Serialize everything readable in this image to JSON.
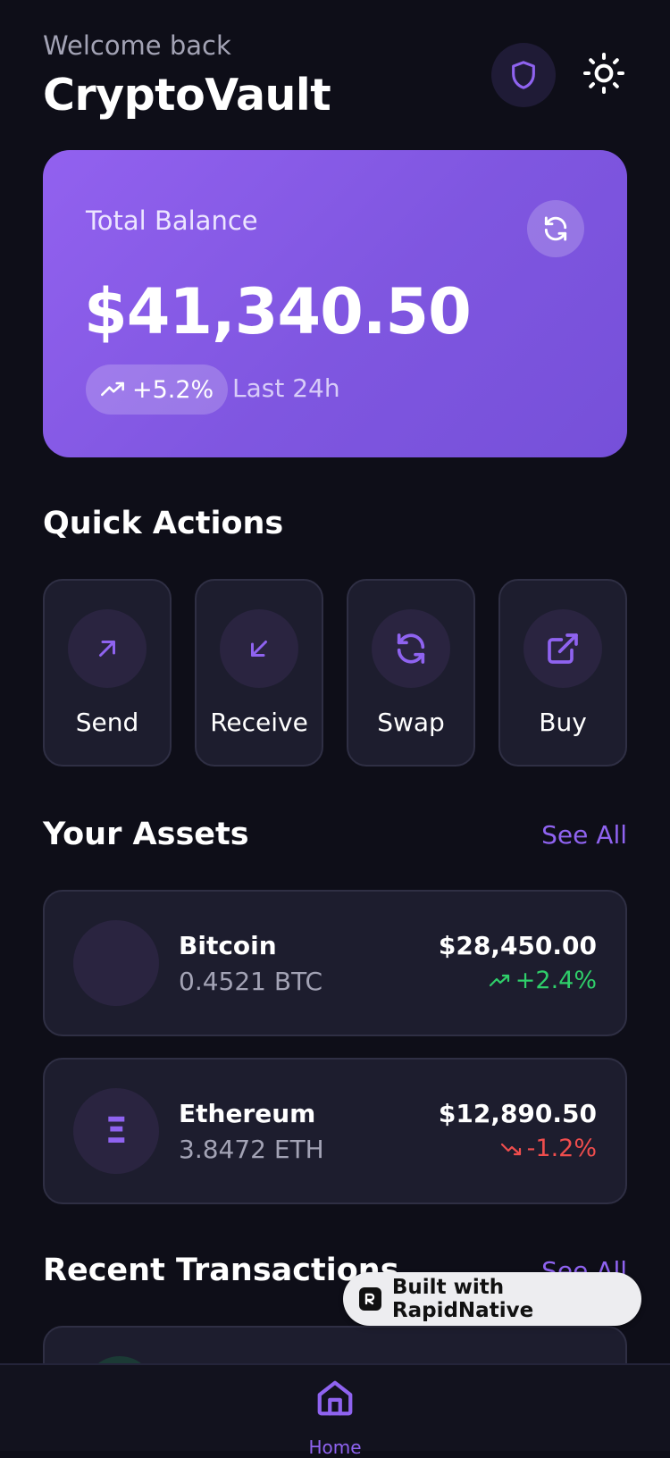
{
  "header": {
    "welcome": "Welcome back",
    "title": "CryptoVault"
  },
  "balance": {
    "label": "Total Balance",
    "amount": "$41,340.50",
    "change": "+5.2%",
    "period": "Last 24h"
  },
  "quick_actions": {
    "title": "Quick Actions",
    "items": [
      {
        "label": "Send",
        "icon": "arrow-up-right-icon"
      },
      {
        "label": "Receive",
        "icon": "arrow-down-left-icon"
      },
      {
        "label": "Swap",
        "icon": "swap-icon"
      },
      {
        "label": "Buy",
        "icon": "external-link-icon"
      }
    ]
  },
  "assets": {
    "title": "Your Assets",
    "see_all": "See All",
    "items": [
      {
        "name": "Bitcoin",
        "amount": "0.4521 BTC",
        "value": "$28,450.00",
        "change": "+2.4%",
        "symbol": "",
        "trend": "up"
      },
      {
        "name": "Ethereum",
        "amount": "3.8472 ETH",
        "value": "$12,890.50",
        "change": "-1.2%",
        "symbol": "Ξ",
        "trend": "down"
      }
    ]
  },
  "transactions": {
    "title": "Recent Transactions",
    "see_all": "See All"
  },
  "nav": {
    "home": "Home"
  },
  "badge": {
    "text": "Built with RapidNative"
  },
  "colors": {
    "accent": "#8f63f0",
    "positive": "#2fcf6a",
    "negative": "#ef4d4d",
    "background": "#0e0e18",
    "card": "#1d1d2e"
  }
}
